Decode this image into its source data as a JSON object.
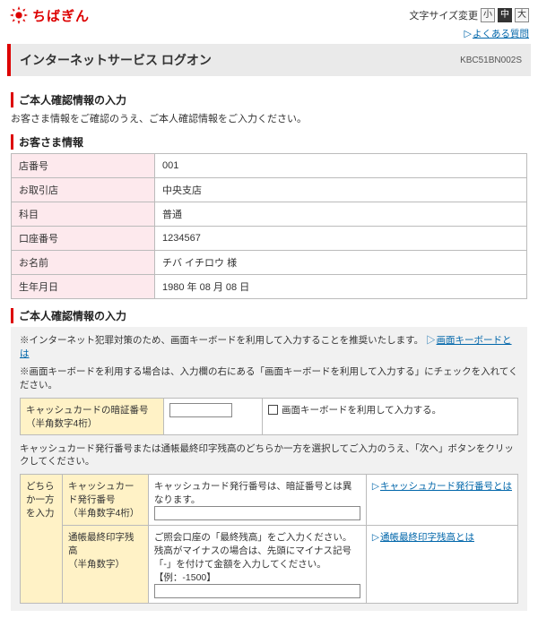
{
  "header": {
    "bank_name": "ちばぎん",
    "font_size_label": "文字サイズ変更",
    "fs_small": "小",
    "fs_med": "中",
    "fs_large": "大",
    "faq": "よくある質問"
  },
  "page": {
    "title": "インターネットサービス ログオン",
    "screen_id": "KBC51BN002S"
  },
  "sec1": {
    "heading": "ご本人確認情報の入力",
    "caption": "お客さま情報をご確認のうえ、ご本人確認情報をご入力ください。"
  },
  "customer": {
    "heading": "お客さま情報",
    "rows": [
      {
        "label": "店番号",
        "value": "001"
      },
      {
        "label": "お取引店",
        "value": "中央支店"
      },
      {
        "label": "科目",
        "value": "普通"
      },
      {
        "label": "口座番号",
        "value": "1234567"
      },
      {
        "label": "お名前",
        "value": "チバ イチロウ 様"
      },
      {
        "label": "生年月日",
        "value": "1980 年 08 月 08 日"
      }
    ]
  },
  "verify": {
    "heading": "ご本人確認情報の入力",
    "instr_line1": "※インターネット犯罪対策のため、画面キーボードを利用して入力することを推奨いたします。 ",
    "instr_link1": "画面キーボードとは",
    "instr_line2": "※画面キーボードを利用する場合は、入力欄の右にある「画面キーボードを利用して入力する」にチェックを入れてください。",
    "pin_label": "キャッシュカードの暗証番号",
    "pin_note": "（半角数字4桁）",
    "screen_kb_cb": "画面キーボードを利用して入力する。",
    "middle_text": "キャッシュカード発行番号または通帳最終印字残高のどちらか一方を選択してご入力のうえ、「次へ」ボタンをクリックしてください。",
    "either_label": "どちらか一方を入力",
    "issue_no_label": "キャッシュカード発行番号",
    "issue_no_note": "（半角数字4桁）",
    "issue_no_desc": "キャッシュカード発行番号は、暗証番号とは異なります。",
    "issue_no_link": "キャッシュカード発行番号とは",
    "balance_label": "通帳最終印字残高",
    "balance_note": "（半角数字）",
    "balance_desc1": "ご照会口座の「最終残高」をご入力ください。",
    "balance_desc2": "残高がマイナスの場合は、先頭にマイナス記号「-」を付けて金額を入力してください。",
    "balance_desc3": "【例：-1500】",
    "balance_link": "通帳最終印字残高とは"
  }
}
